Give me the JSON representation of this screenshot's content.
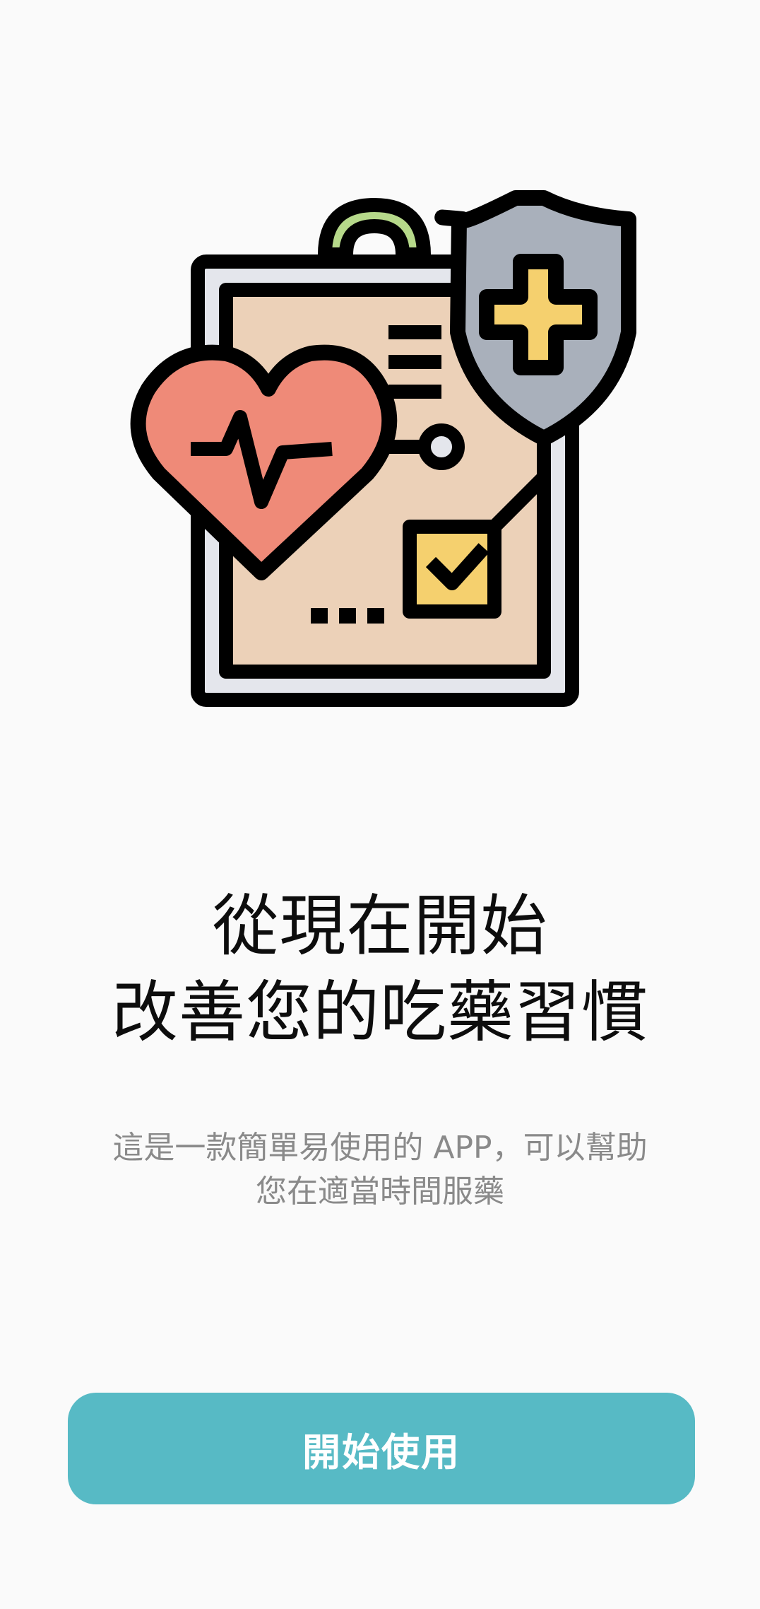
{
  "onboarding": {
    "illustration_icon": "medical-record-clipboard-icon",
    "headline_line1": "從現在開始",
    "headline_line2": "改善您的吃藥習慣",
    "subtitle_line1": "這是一款簡單易使用的 APP，可以幫助",
    "subtitle_line2": "您在適當時間服藥",
    "start_button_label": "開始使用"
  },
  "colors": {
    "background": "#fafafa",
    "accent": "#57bac5",
    "heart": "#ef8a78",
    "shield": "#a9b0bb",
    "cross": "#f5d06e",
    "paper": "#ecd1b8",
    "clip": "#b6d98a"
  }
}
